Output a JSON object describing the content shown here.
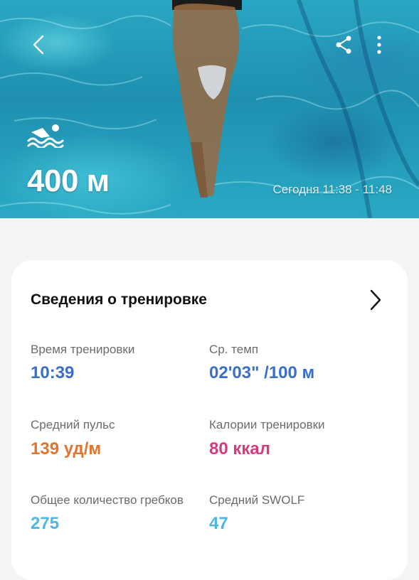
{
  "workout": {
    "distance": "400 м",
    "time_range": "Сегодня 11:38 - 11:48",
    "activity_icon": "swimming-icon"
  },
  "toolbar": {
    "back_icon": "chevron-left-icon",
    "share_icon": "share-icon",
    "more_icon": "more-vertical-icon"
  },
  "details": {
    "title": "Сведения о тренировке",
    "metrics": [
      {
        "label": "Время тренировки",
        "value": "10:39",
        "color": "#3a6fc9"
      },
      {
        "label": "Ср. темп",
        "value": "02'03\" /100 м",
        "color": "#3a6fc9"
      },
      {
        "label": "Средний пульс",
        "value": "139 уд/м",
        "color": "#e0752f"
      },
      {
        "label": "Калории тренировки",
        "value": "80 ккал",
        "color": "#d63a7c"
      },
      {
        "label": "Общее количество гребков",
        "value": "275",
        "color": "#4fb6e3"
      },
      {
        "label": "Средний SWOLF",
        "value": "47",
        "color": "#4fb6e3"
      }
    ]
  }
}
